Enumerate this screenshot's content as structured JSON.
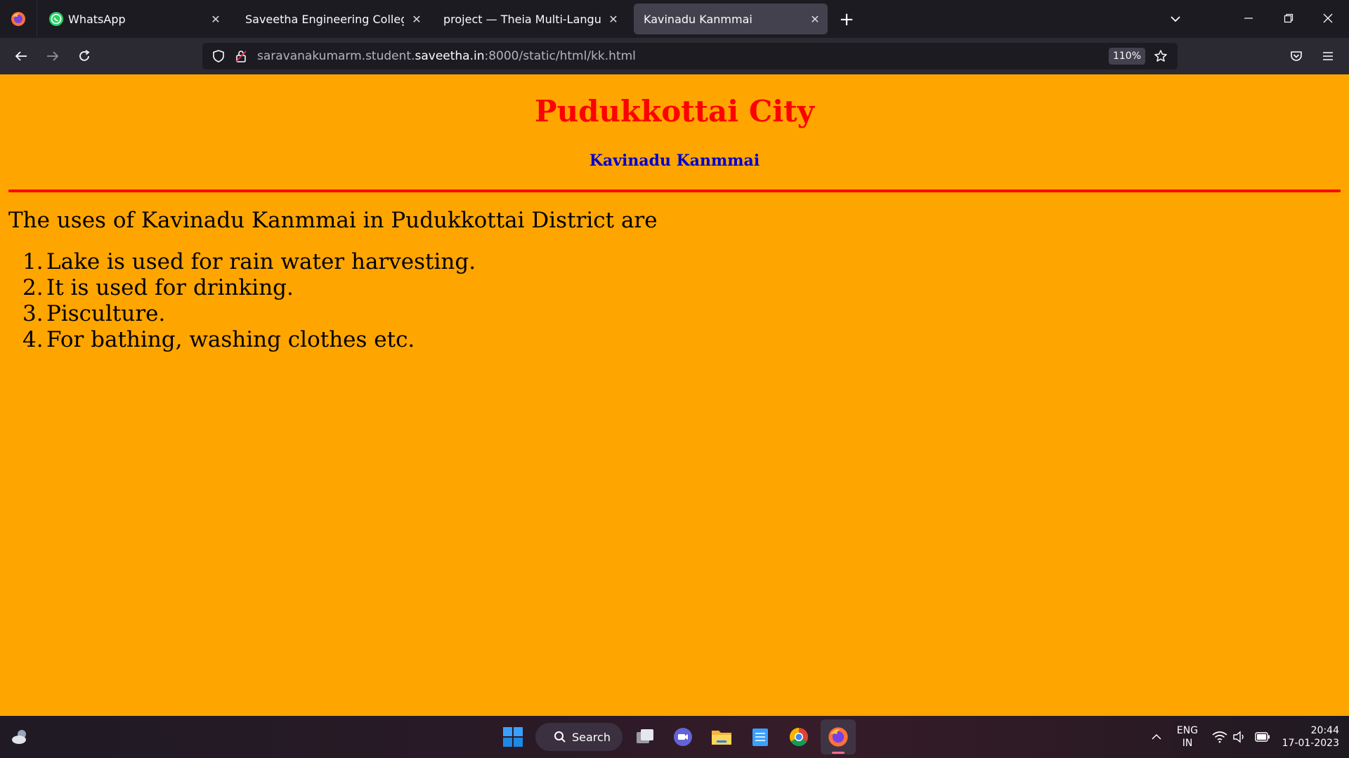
{
  "browser": {
    "tabs": [
      {
        "title": "WhatsApp",
        "icon": "whatsapp-icon",
        "active": false
      },
      {
        "title": "Saveetha Engineering College",
        "icon": "",
        "active": false
      },
      {
        "title": "project — Theia Multi-Language Ex",
        "icon": "",
        "active": false
      },
      {
        "title": "Kavinadu Kanmmai",
        "icon": "",
        "active": true
      }
    ],
    "url": {
      "prefix": "saravanakumarm.student.",
      "domain": "saveetha.in",
      "suffix": ":8000/static/html/kk.html"
    },
    "zoom": "110%"
  },
  "page": {
    "background": "#ffa500",
    "title": "Pudukkottai City",
    "title_color": "#ff0000",
    "subtitle": "Kavinadu Kanmmai",
    "subtitle_color": "#0000cd",
    "intro": "The uses of Kavinadu Kanmmai in Pudukkottai District are",
    "uses": [
      {
        "num": "1.",
        "text": "Lake is used for rain water harvesting."
      },
      {
        "num": "2.",
        "text": "It is used for drinking."
      },
      {
        "num": "3.",
        "text": "Pisculture."
      },
      {
        "num": "4.",
        "text": "For bathing, washing clothes etc."
      }
    ]
  },
  "taskbar": {
    "search_label": "Search",
    "language": "ENG",
    "region": "IN",
    "time": "20:44",
    "date": "17-01-2023"
  }
}
